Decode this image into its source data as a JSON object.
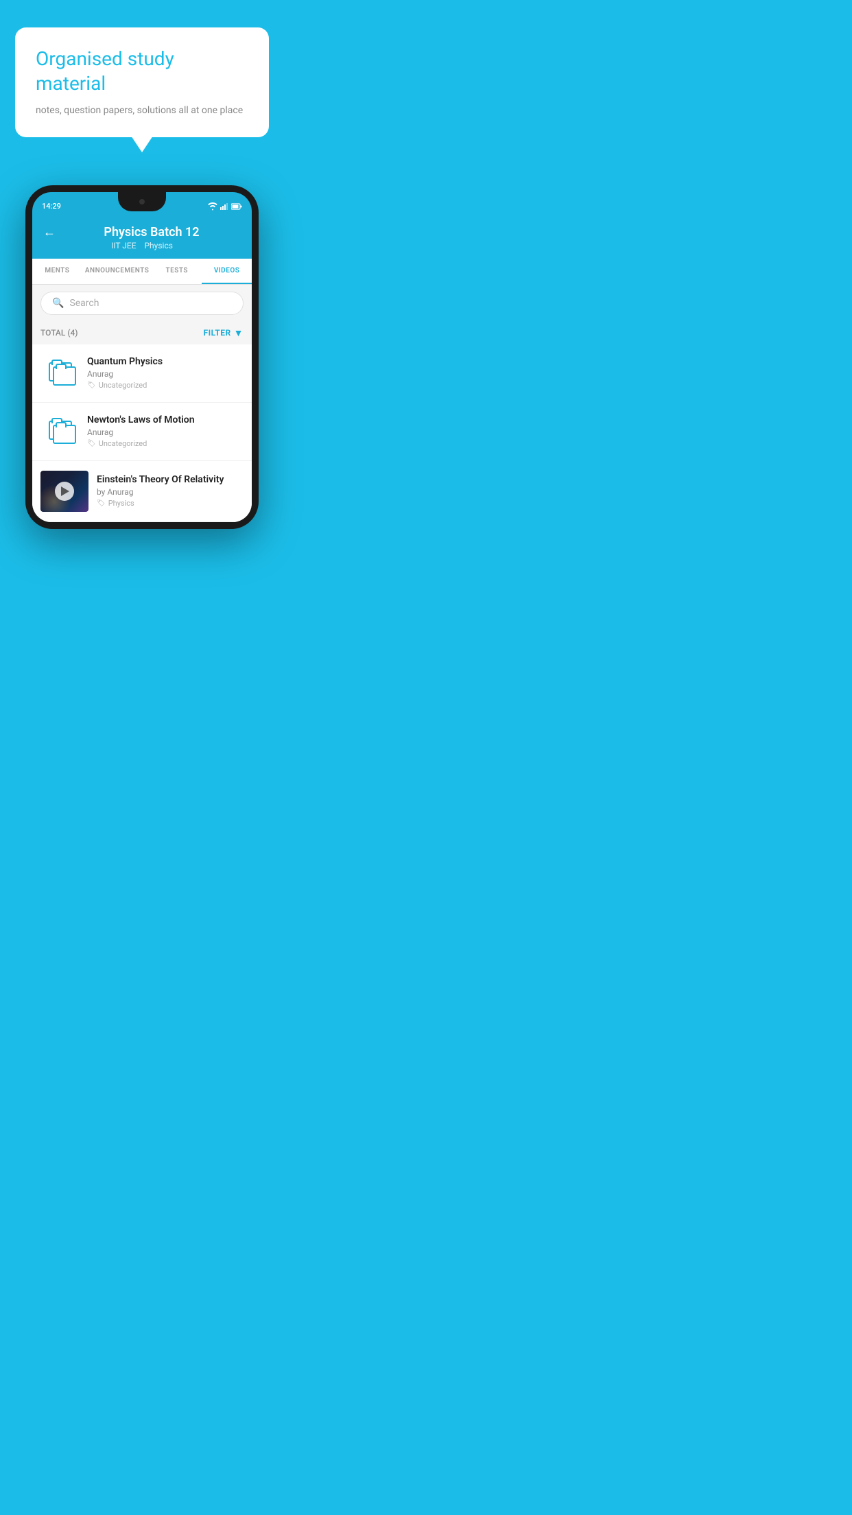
{
  "background_color": "#1BBDE8",
  "bubble": {
    "title": "Organised study material",
    "subtitle": "notes, question papers, solutions all at one place"
  },
  "phone": {
    "status_bar": {
      "time": "14:29"
    },
    "app_bar": {
      "title": "Physics Batch 12",
      "subtitle_tag1": "IIT JEE",
      "subtitle_tag2": "Physics",
      "back_label": "←"
    },
    "tabs": [
      {
        "label": "MENTS",
        "active": false
      },
      {
        "label": "ANNOUNCEMENTS",
        "active": false
      },
      {
        "label": "TESTS",
        "active": false
      },
      {
        "label": "VIDEOS",
        "active": true
      }
    ],
    "search": {
      "placeholder": "Search"
    },
    "filter_bar": {
      "total_label": "TOTAL (4)",
      "filter_label": "FILTER"
    },
    "videos": [
      {
        "id": 1,
        "title": "Quantum Physics",
        "author": "Anurag",
        "tag": "Uncategorized",
        "thumb_type": "folder"
      },
      {
        "id": 2,
        "title": "Newton's Laws of Motion",
        "author": "Anurag",
        "tag": "Uncategorized",
        "thumb_type": "folder"
      },
      {
        "id": 3,
        "title": "Einstein's Theory Of Relativity",
        "author": "by Anurag",
        "tag": "Physics",
        "thumb_type": "video"
      }
    ]
  }
}
